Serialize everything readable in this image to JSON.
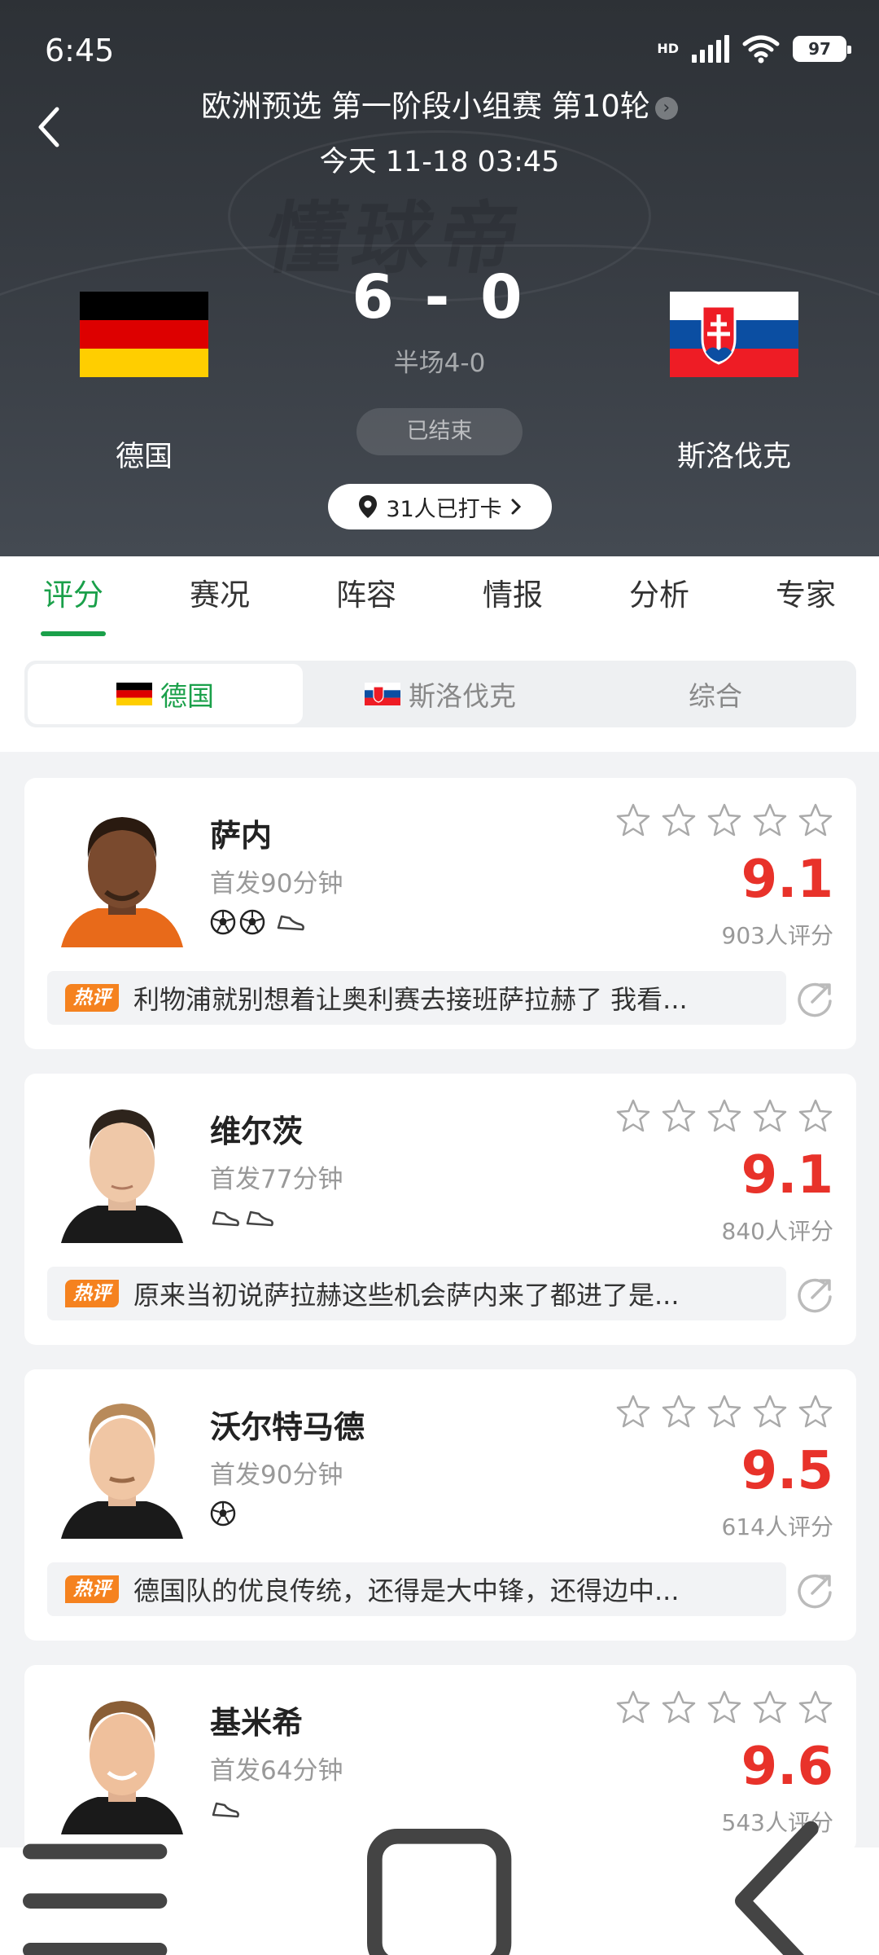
{
  "status_bar": {
    "time": "6:45",
    "network": "HD",
    "battery": "97"
  },
  "match": {
    "competition": "欧洲预选 第一阶段小组赛 第10轮",
    "datetime": "今天 11-18 03:45",
    "home_team": "德国",
    "away_team": "斯洛伐克",
    "score": "6 - 0",
    "halftime": "半场4-0",
    "status": "已结束",
    "checkin": "31人已打卡",
    "watermark": "懂球帝"
  },
  "tabs": [
    "评分",
    "赛况",
    "阵容",
    "情报",
    "分析",
    "专家"
  ],
  "segments": [
    "德国",
    "斯洛伐克",
    "综合"
  ],
  "colors": {
    "accent": "#1aa04a",
    "rating": "#e8322a",
    "hot": "#f5821f"
  },
  "hot_label": "热评",
  "players": [
    {
      "name": "萨内",
      "minutes": "首发90分钟",
      "rating": "9.1",
      "votes": "903人评分",
      "comment": "利物浦就别想着让奥利赛去接班萨拉赫了 我看...",
      "goals": 2,
      "assists": 1
    },
    {
      "name": "维尔茨",
      "minutes": "首发77分钟",
      "rating": "9.1",
      "votes": "840人评分",
      "comment": "原来当初说萨拉赫这些机会萨内来了都进了是...",
      "goals": 0,
      "assists": 2
    },
    {
      "name": "沃尔特马德",
      "minutes": "首发90分钟",
      "rating": "9.5",
      "votes": "614人评分",
      "comment": "德国队的优良传统，还得是大中锋，还得边中...",
      "goals": 1,
      "assists": 0
    },
    {
      "name": "基米希",
      "minutes": "首发64分钟",
      "rating": "9.6",
      "votes": "543人评分",
      "comment": "",
      "goals": 0,
      "assists": 1
    }
  ]
}
